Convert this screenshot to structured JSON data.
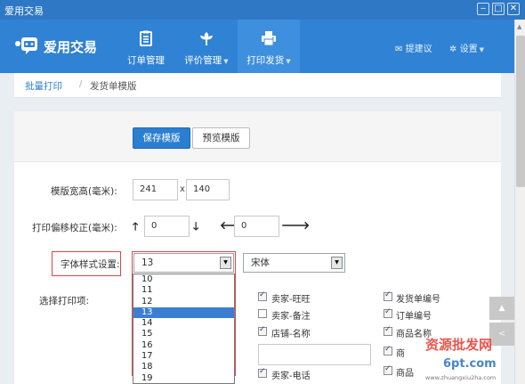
{
  "window": {
    "title": "爱用交易",
    "controls": {
      "minimize": "‒",
      "maximize": "□",
      "close": "✕"
    }
  },
  "brand": {
    "name": "爱用交易",
    "color": "#2f82d4"
  },
  "nav": {
    "items": [
      {
        "label": "订单管理",
        "icon": "clipboard-icon"
      },
      {
        "label": "评价管理",
        "icon": "flower-icon",
        "has_dropdown": true
      },
      {
        "label": "打印发货",
        "icon": "printer-icon",
        "has_dropdown": true,
        "active": true
      }
    ],
    "right": [
      {
        "label": "提建议",
        "icon": "envelope-icon"
      },
      {
        "label": "设置",
        "icon": "gear-icon",
        "has_dropdown": true
      }
    ]
  },
  "breadcrumb": {
    "parent": "批量打印",
    "separator": "/",
    "current": "发货单模版"
  },
  "toolbar": {
    "save_label": "保存模版",
    "preview_label": "预览模版"
  },
  "form": {
    "size": {
      "label": "模版宽高(毫米):",
      "width": "241",
      "separator": "x",
      "height": "140"
    },
    "offset": {
      "label": "打印偏移校正(毫米):",
      "vertical": "0",
      "horizontal": "0"
    },
    "font": {
      "label": "字体样式设置:",
      "size_value": "13",
      "family_value": "宋体",
      "size_options": [
        "10",
        "11",
        "12",
        "13",
        "14",
        "15",
        "16",
        "17",
        "18",
        "19"
      ],
      "selected_index": 3
    },
    "print_items": {
      "label": "选择打印项:",
      "column2": [
        {
          "label": "卖家-旺旺",
          "checked": true
        },
        {
          "label": "卖家-备注",
          "checked": false
        },
        {
          "label": "店铺-名称",
          "checked": true
        },
        {
          "label": "",
          "type": "text-input"
        },
        {
          "label": "卖家-电话",
          "checked": true
        }
      ],
      "column3": [
        {
          "label": "发货单编号",
          "checked": true
        },
        {
          "label": "订单编号",
          "checked": true
        },
        {
          "label": "商品名称",
          "checked": true
        },
        {
          "label": "商",
          "checked": true
        },
        {
          "label": "商品",
          "checked": true
        }
      ]
    }
  },
  "side_buttons": {
    "up": "▲",
    "expand": "<"
  },
  "watermark": {
    "line1": "资源批发网",
    "line2": "6pt.com",
    "line3": "www.zhuangxiu2ha.com"
  }
}
